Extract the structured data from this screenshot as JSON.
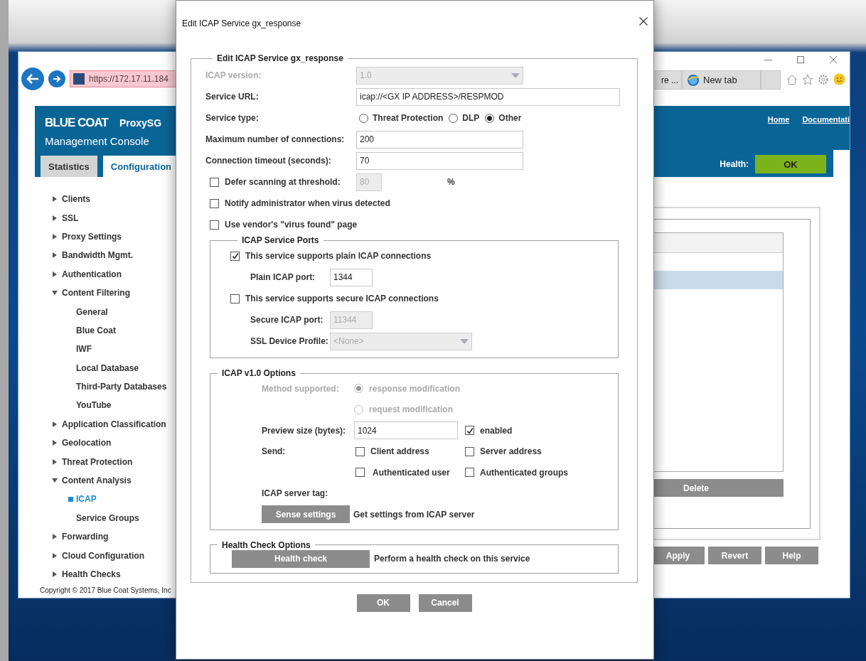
{
  "browser": {
    "address": "https://172.17.11.184",
    "tabs": [
      {
        "label": "re ...",
        "selected": false
      },
      {
        "label": "New tab",
        "selected": false
      }
    ]
  },
  "app": {
    "brand": "BLUE COAT",
    "product": "ProxySG",
    "subtitle": "Management Console",
    "links": [
      "Home",
      "Documentati"
    ],
    "health_label": "Health:",
    "health_status": "OK",
    "tabs": [
      {
        "label": "Statistics",
        "selected": false
      },
      {
        "label": "Configuration",
        "selected": true
      }
    ],
    "sidebar": [
      {
        "label": "Clients",
        "expanded": false
      },
      {
        "label": "SSL",
        "expanded": false
      },
      {
        "label": "Proxy Settings",
        "expanded": false
      },
      {
        "label": "Bandwidth Mgmt.",
        "expanded": false
      },
      {
        "label": "Authentication",
        "expanded": false
      },
      {
        "label": "Content Filtering",
        "expanded": true,
        "children": [
          {
            "label": "General",
            "selected": false
          },
          {
            "label": "Blue Coat",
            "selected": false
          },
          {
            "label": "IWF",
            "selected": false
          },
          {
            "label": "Local Database",
            "selected": false
          },
          {
            "label": "Third-Party Databases",
            "selected": false
          },
          {
            "label": "YouTube",
            "selected": false
          }
        ]
      },
      {
        "label": "Application Classification",
        "expanded": false
      },
      {
        "label": "Geolocation",
        "expanded": false
      },
      {
        "label": "Threat Protection",
        "expanded": false
      },
      {
        "label": "Content Analysis",
        "expanded": true,
        "children": [
          {
            "label": "ICAP",
            "selected": true
          },
          {
            "label": "Service Groups",
            "selected": false
          }
        ]
      },
      {
        "label": "Forwarding",
        "expanded": false
      },
      {
        "label": "Cloud Configuration",
        "expanded": false
      },
      {
        "label": "Health Checks",
        "expanded": false
      }
    ],
    "copyright": "Copyright © 2017 Blue Coat Systems, Inc",
    "table_rows": [
      {
        "selected": true
      }
    ],
    "delete_button": "Delete",
    "footer_buttons": [
      "Apply",
      "Revert",
      "Help"
    ]
  },
  "dialog": {
    "title": "Edit ICAP Service gx_response",
    "legend": "Edit ICAP Service gx_response",
    "icap_version": {
      "label": "ICAP version:",
      "value": "1.0",
      "disabled": true
    },
    "service_url": {
      "label": "Service URL:",
      "value": "icap://<GX IP ADDRESS>/RESPMOD"
    },
    "service_type": {
      "label": "Service type:",
      "options": [
        {
          "label": "Threat Protection",
          "selected": false
        },
        {
          "label": "DLP",
          "selected": false
        },
        {
          "label": "Other",
          "selected": true
        }
      ]
    },
    "max_connections": {
      "label": "Maximum number of connections:",
      "value": "200"
    },
    "timeout": {
      "label": "Connection timeout (seconds):",
      "value": "70"
    },
    "defer": {
      "label": "Defer scanning at threshold:",
      "checked": false,
      "value": "80",
      "unit": "%"
    },
    "options": [
      {
        "label": "Notify administrator when virus detected",
        "checked": false
      },
      {
        "label": "Use vendor's \"virus found\" page",
        "checked": false
      }
    ],
    "ports": {
      "legend": "ICAP Service Ports",
      "plain": {
        "label": "This service supports plain ICAP connections",
        "checked": true,
        "port_label": "Plain ICAP port:",
        "port": "1344"
      },
      "secure": {
        "label": "This service supports secure ICAP connections",
        "checked": false,
        "port_label": "Secure ICAP port:",
        "port": "11344",
        "profile_label": "SSL Device Profile:",
        "profile": "<None>"
      }
    },
    "v1_options": {
      "legend": "ICAP v1.0 Options",
      "method_label": "Method supported:",
      "disabled": true,
      "methods": [
        {
          "label": "response modification",
          "selected": true
        },
        {
          "label": "request modification",
          "selected": false
        }
      ],
      "preview_label": "Preview size (bytes):",
      "preview": "1024",
      "preview_enabled": {
        "label": "enabled",
        "checked": true
      },
      "send_label": "Send:",
      "send": [
        {
          "label": "Client address",
          "checked": false
        },
        {
          "label": "Server address",
          "checked": false
        },
        {
          "label": "Authenticated user",
          "checked": false
        },
        {
          "label": "Authenticated groups",
          "checked": false
        }
      ],
      "tag_label": "ICAP server tag:",
      "sense_button": "Sense settings",
      "sense_text": "Get settings from ICAP server"
    },
    "health": {
      "legend": "Health Check Options",
      "button": "Health check",
      "text": "Perform a health check on this service"
    },
    "buttons": [
      "OK",
      "Cancel"
    ]
  }
}
